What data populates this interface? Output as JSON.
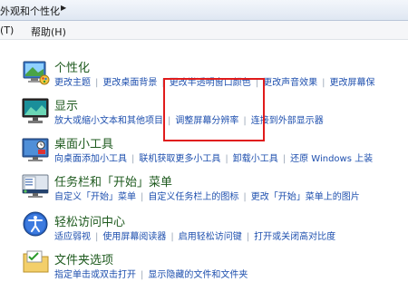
{
  "address_bar": {
    "crumb": "外观和个性化",
    "arrow": "▶"
  },
  "menu": {
    "items": [
      "(T)",
      "帮助(H)"
    ]
  },
  "categories": [
    {
      "title": "个性化",
      "icon": "personalization-icon",
      "links": [
        "更改主题",
        "更改桌面背景",
        "更改半透明窗口颜色",
        "更改声音效果",
        "更改屏幕保"
      ]
    },
    {
      "title": "显示",
      "icon": "display-icon",
      "links": [
        "放大或缩小文本和其他项目",
        "调整屏幕分辨率",
        "连接到外部显示器"
      ]
    },
    {
      "title": "桌面小工具",
      "icon": "gadgets-icon",
      "links": [
        "向桌面添加小工具",
        "联机获取更多小工具",
        "卸载小工具",
        "还原 Windows 上装"
      ]
    },
    {
      "title": "任务栏和「开始」菜单",
      "icon": "taskbar-icon",
      "links": [
        "自定义「开始」菜单",
        "自定义任务栏上的图标",
        "更改「开始」菜单上的图片"
      ]
    },
    {
      "title": "轻松访问中心",
      "icon": "ease-of-access-icon",
      "links": [
        "适应弱视",
        "使用屏幕阅读器",
        "启用轻松访问键",
        "打开或关闭高对比度"
      ]
    },
    {
      "title": "文件夹选项",
      "icon": "folder-options-icon",
      "links": [
        "指定单击或双击打开",
        "显示隐藏的文件和文件夹"
      ]
    }
  ],
  "highlight_color": "#e01b1b"
}
